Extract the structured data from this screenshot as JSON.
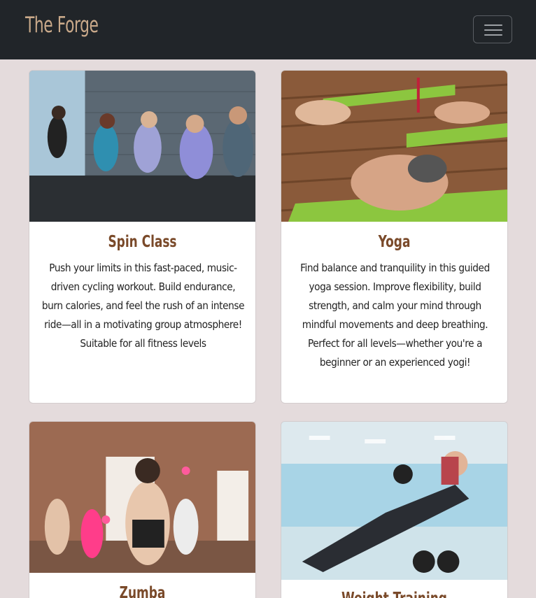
{
  "navbar": {
    "brand": "The Forge",
    "toggle_icon": "menu-icon"
  },
  "classes": [
    {
      "title": "Spin Class",
      "description": "Push your limits in this fast-paced, music-driven cycling workout. Build endurance, burn calories, and feel the rush of an intense ride—all in a motivating group atmosphere! Suitable for all fitness levels",
      "image": "spin-class-photo"
    },
    {
      "title": "Yoga",
      "description": "Find balance and tranquility in this guided yoga session. Improve flexibility, build strength, and calm your mind through mindful movements and deep breathing. Perfect for all levels—whether you're a beginner or an experienced yogi!",
      "image": "yoga-photo"
    },
    {
      "title": "Zumba",
      "description": "",
      "image": "zumba-photo"
    },
    {
      "title": "Weight Training",
      "description": "",
      "image": "weight-training-photo"
    }
  ]
}
